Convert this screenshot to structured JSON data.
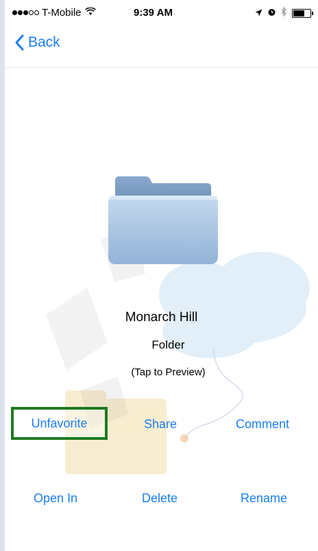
{
  "status_bar": {
    "carrier": "T-Mobile",
    "time": "9:39 AM",
    "signal_bars_filled": 3,
    "signal_bars_total": 5,
    "battery_level": 0.7
  },
  "nav": {
    "back_label": "Back"
  },
  "item": {
    "name": "Monarch Hill",
    "type": "Folder",
    "hint": "(Tap to Preview)"
  },
  "actions": {
    "unfavorite": "Unfavorite",
    "share": "Share",
    "comment": "Comment",
    "open_in": "Open In",
    "delete": "Delete",
    "rename": "Rename"
  },
  "colors": {
    "accent": "#1a7ef5",
    "highlight_border": "#1e7a21",
    "folder_blue": "#8fb2d9"
  }
}
